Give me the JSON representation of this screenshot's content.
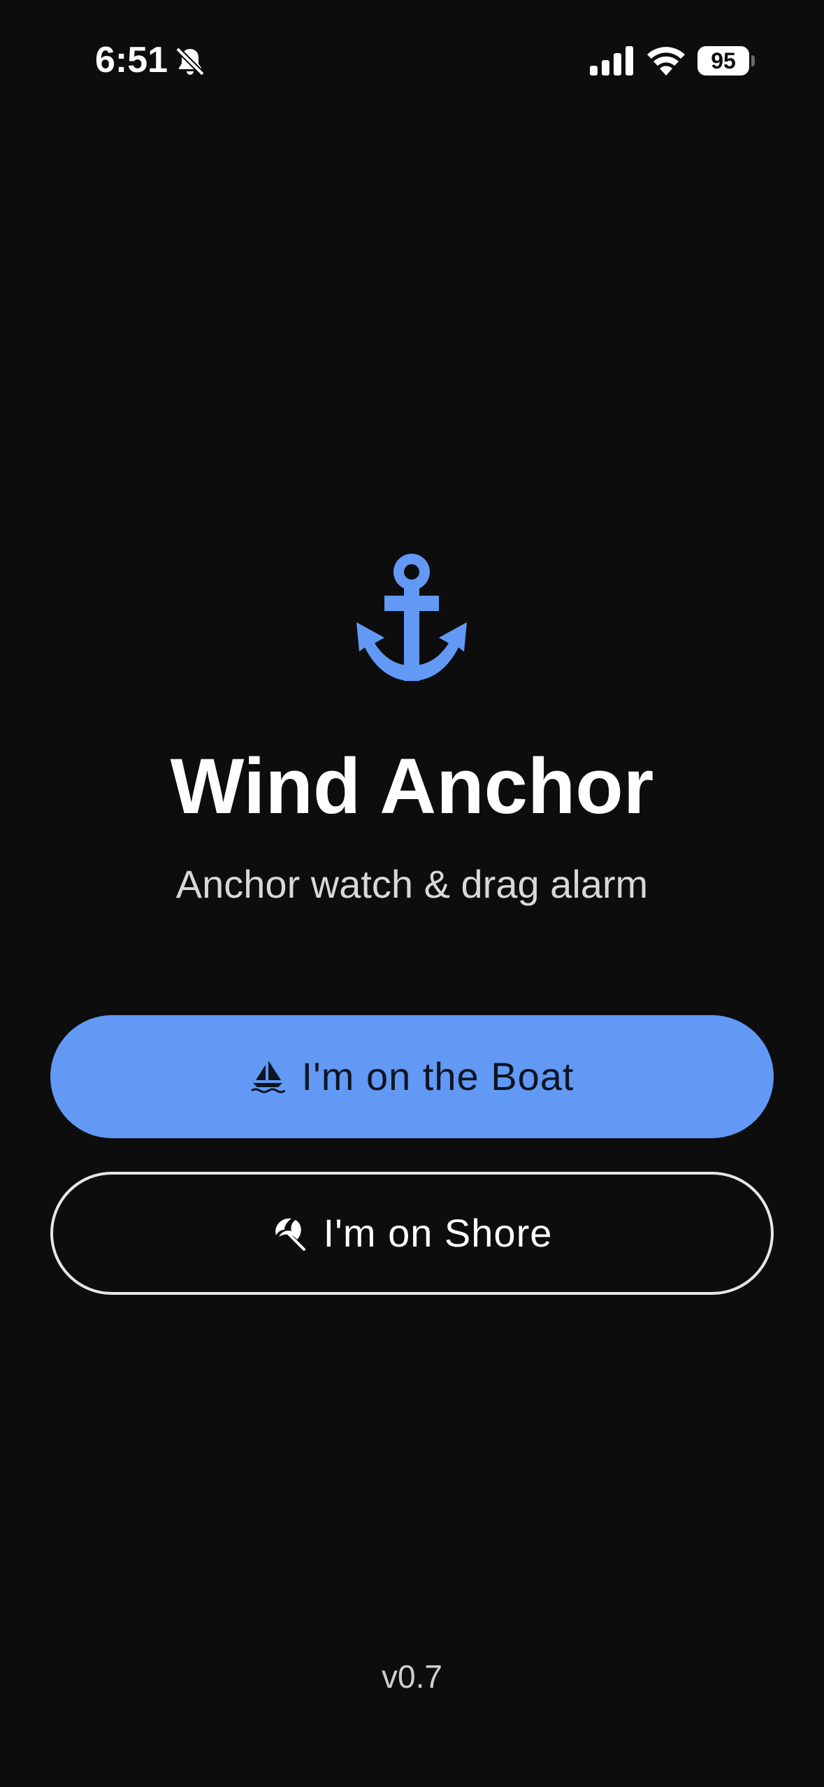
{
  "status_bar": {
    "time": "6:51",
    "battery_level": "95",
    "icons": [
      "bell-slash-icon",
      "cellular-signal-icon",
      "wifi-icon",
      "battery-icon"
    ]
  },
  "app": {
    "icon": "anchor-icon",
    "title": "Wind Anchor",
    "subtitle": "Anchor watch & drag alarm",
    "accent_color": "#6199f5",
    "background_color": "#0d0d0e"
  },
  "buttons": {
    "boat": {
      "label": "I'm on the Boat",
      "icon": "sailboat-icon"
    },
    "shore": {
      "label": "I'm on Shore",
      "icon": "beach-umbrella-icon"
    }
  },
  "footer": {
    "version": "v0.7"
  }
}
